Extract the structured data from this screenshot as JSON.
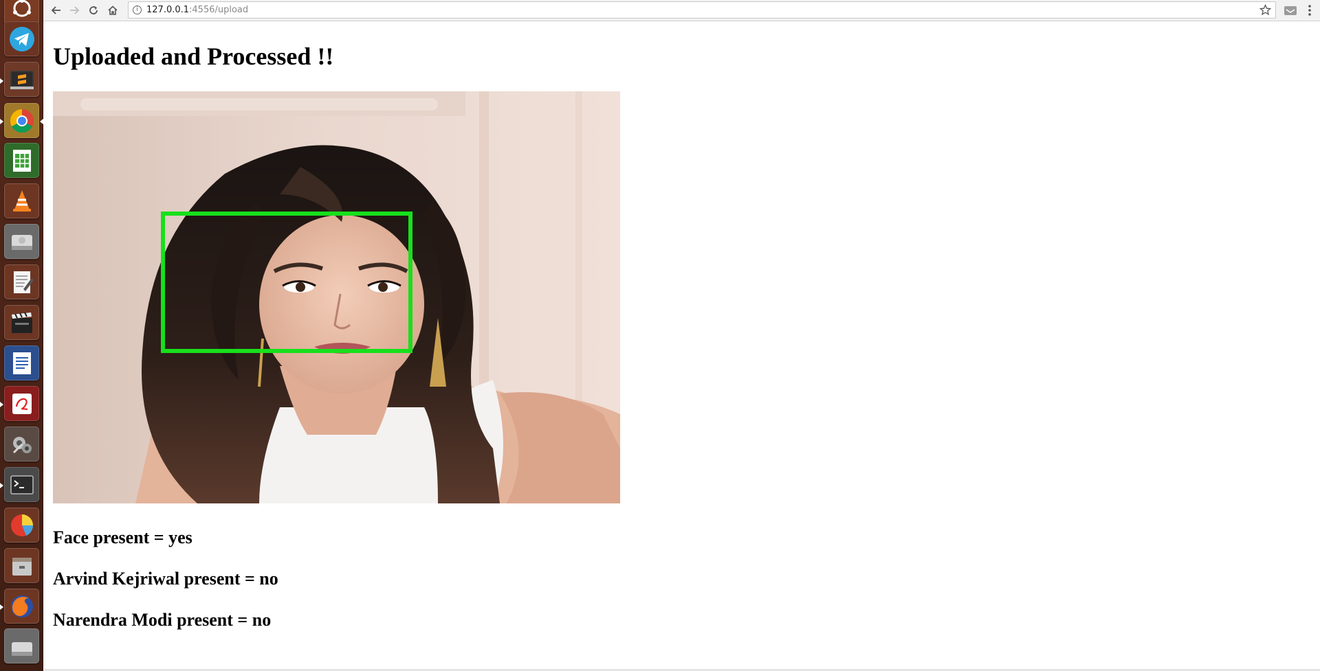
{
  "browser": {
    "url_host": "127.0.0.1",
    "url_rest": ":4556/upload"
  },
  "launcher": {
    "items": [
      "ubuntu-dash-icon",
      "telegram-icon",
      "sublime-text-icon",
      "chrome-icon",
      "libreoffice-calc-icon",
      "vlc-icon",
      "disk-drive-icon",
      "text-editor-icon",
      "video-editor-icon",
      "libreoffice-writer-icon",
      "evince-icon",
      "system-settings-icon",
      "terminal-icon",
      "disk-usage-icon",
      "file-archive-icon",
      "firefox-icon",
      "removable-drive-icon"
    ]
  },
  "page": {
    "title": "Uploaded and Processed !!",
    "results": [
      "Face present = yes",
      "Arvind Kejriwal present = no",
      "Narendra Modi present = no"
    ],
    "face_box_color": "#17e01b"
  }
}
